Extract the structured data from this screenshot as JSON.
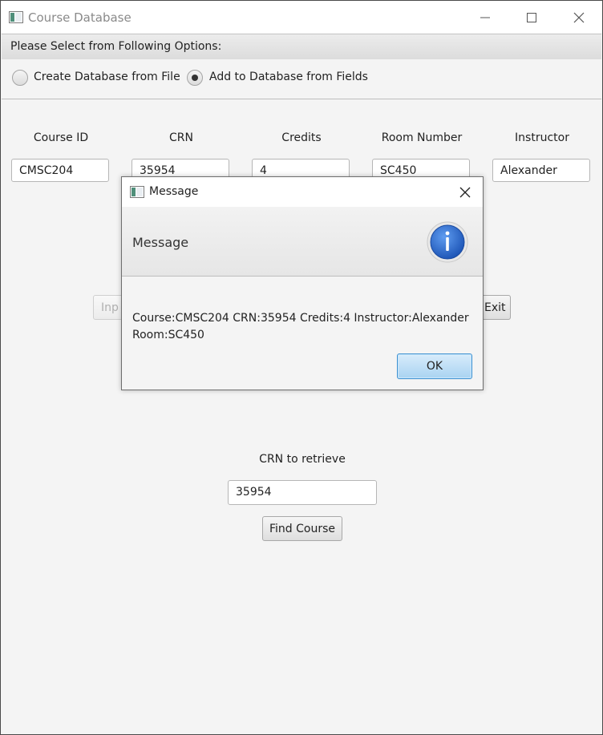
{
  "window": {
    "title": "Course Database"
  },
  "header": {
    "text": "Please Select from Following Options:"
  },
  "options": {
    "radio_file": {
      "label": "Create Database from File",
      "selected": false
    },
    "radio_fields": {
      "label": "Add to Database from Fields",
      "selected": true
    }
  },
  "fields": {
    "course_id": {
      "label": "Course ID",
      "value": "CMSC204"
    },
    "crn": {
      "label": "CRN",
      "value": "35954"
    },
    "credits": {
      "label": "Credits",
      "value": "4"
    },
    "room": {
      "label": "Room Number",
      "value": "SC450"
    },
    "instructor": {
      "label": "Instructor",
      "value": "Alexander"
    }
  },
  "buttons": {
    "input_partial": "Inp",
    "exit": "Exit"
  },
  "retrieve": {
    "label": "CRN to retrieve",
    "value": "35954",
    "button": "Find Course"
  },
  "dialog": {
    "title": "Message",
    "header": "Message",
    "content_line1": "Course:CMSC204 CRN:35954 Credits:4 Instructor:Alexander",
    "content_line2": "Room:SC450",
    "ok_label": "OK",
    "icon": "info-icon",
    "icon_color": "#2f6fd0"
  },
  "colors": {
    "window_bg": "#f4f4f4",
    "focus_blue": "#3a8fd0"
  }
}
